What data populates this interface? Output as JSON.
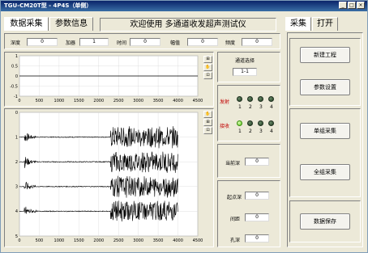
{
  "window": {
    "title": "TGU-CM20T型 - 4P4S（单侧）",
    "min_glyph": "_",
    "max_glyph": "□",
    "close_glyph": "×"
  },
  "tabs_left": [
    {
      "label": "数据采集",
      "active": true
    },
    {
      "label": "参数信息",
      "active": false
    }
  ],
  "banner": "欢迎使用 多通道收发超声测试仪",
  "tabs_right": [
    {
      "label": "采集",
      "active": true
    },
    {
      "label": "打开",
      "active": false
    }
  ],
  "params": {
    "depth_label": "深度",
    "depth_value": "0",
    "gain_label": "加器",
    "gain_value": "1",
    "time_label": "时间",
    "time_value": "0",
    "amplitude_label": "幅值",
    "amplitude_value": "0",
    "frequency_label": "频度",
    "frequency_value": "0"
  },
  "top_plot": {
    "y_ticks": [
      "1",
      "0.5",
      "0",
      "-0.5",
      "-1"
    ],
    "x_ticks": [
      "0",
      "500",
      "1000",
      "1500",
      "2000",
      "2500",
      "3000",
      "3500",
      "4000",
      "4500"
    ]
  },
  "bottom_plot": {
    "y_ticks": [
      "0",
      "1",
      "2",
      "3",
      "4",
      "5"
    ],
    "x_ticks": [
      "0",
      "500",
      "1000",
      "1500",
      "2000",
      "2500",
      "3000",
      "3500",
      "4000",
      "4500"
    ]
  },
  "side_buttons": {
    "top": [
      "⊞",
      "✋",
      "⊡"
    ],
    "bottom": [
      "✋",
      "⊞",
      "⊡"
    ]
  },
  "channel": {
    "title": "通道选择",
    "value": "1-1"
  },
  "transmit": {
    "label": "发射",
    "leds": [
      false,
      false,
      false,
      false
    ],
    "numbers": [
      "1",
      "2",
      "3",
      "4"
    ]
  },
  "receive": {
    "label": "接收",
    "leds": [
      true,
      false,
      false,
      false
    ],
    "numbers": [
      "1",
      "2",
      "3",
      "4"
    ]
  },
  "current_depth": {
    "label": "当前深",
    "value": "0"
  },
  "start_depth": {
    "label": "起点深",
    "value": "0"
  },
  "spacing": {
    "label": "间距",
    "value": "0"
  },
  "hole_depth": {
    "label": "孔深",
    "value": "0"
  },
  "actions": {
    "new_project": "新建工程",
    "param_settings": "参数设置",
    "single_collect": "单组采集",
    "all_collect": "全组采集",
    "save_data": "数据保存"
  },
  "colors": {
    "title_bar": "#0a246a",
    "window_bg": "#ece9d8",
    "label_red": "#c00000",
    "led_on": "#5ac81a",
    "led_off": "#1e3a1e"
  }
}
